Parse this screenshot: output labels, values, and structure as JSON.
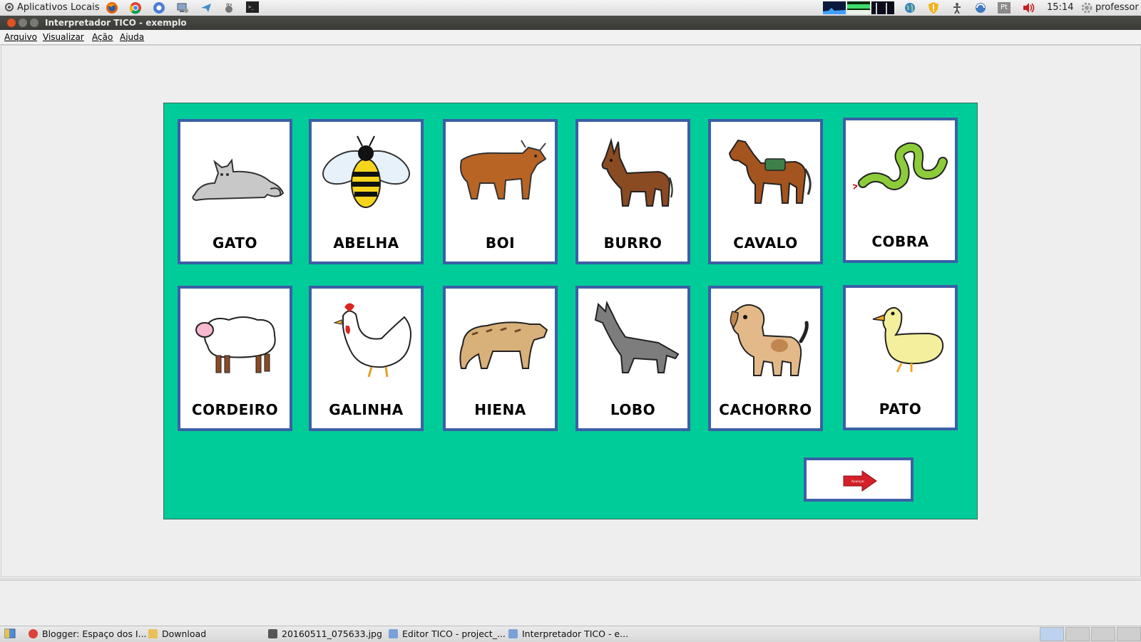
{
  "top_panel": {
    "applications": "Aplicativos",
    "places": "Locais",
    "clock": "15:14",
    "keyboard_layout": "Pt",
    "user": "professor"
  },
  "window": {
    "title": "Interpretador TICO - exemplo"
  },
  "menu": {
    "items": [
      "Arquivo",
      "Visualizar",
      "Ação",
      "Ajuda"
    ]
  },
  "board": {
    "background_color": "#00cc99",
    "cards": [
      {
        "label": "GATO",
        "icon": "cat-icon"
      },
      {
        "label": "ABELHA",
        "icon": "bee-icon"
      },
      {
        "label": "BOI",
        "icon": "ox-icon"
      },
      {
        "label": "BURRO",
        "icon": "donkey-icon"
      },
      {
        "label": "CAVALO",
        "icon": "horse-icon"
      },
      {
        "label": "COBRA",
        "icon": "snake-icon"
      },
      {
        "label": "CORDEIRO",
        "icon": "lamb-icon"
      },
      {
        "label": "GALINHA",
        "icon": "hen-icon"
      },
      {
        "label": "HIENA",
        "icon": "hyena-icon"
      },
      {
        "label": "LOBO",
        "icon": "wolf-icon"
      },
      {
        "label": "CACHORRO",
        "icon": "dog-icon"
      },
      {
        "label": "PATO",
        "icon": "duck-icon"
      }
    ],
    "next_button": {
      "label": "Avançar",
      "icon": "red-arrow-icon"
    }
  },
  "taskbar": {
    "tasks": [
      "Blogger: Espaço dos I...",
      "Download",
      "20160511_075633.jpg",
      "Editor TICO - project_...",
      "Interpretador TICO - e..."
    ]
  },
  "colors": {
    "card_border": "#3a5fa6",
    "titlebar": "#3c3b37",
    "arrow": "#d4202a"
  }
}
